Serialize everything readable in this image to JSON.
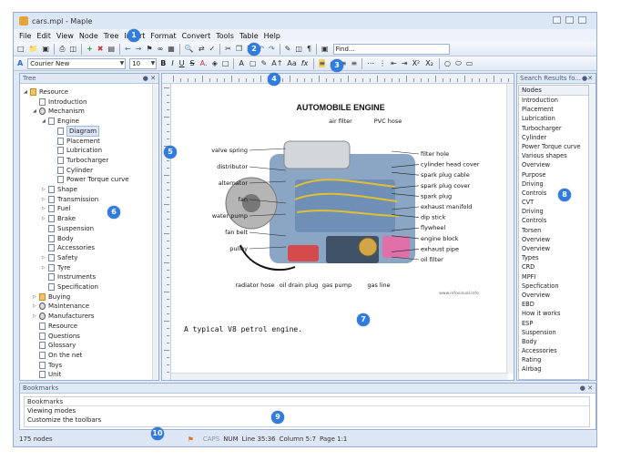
{
  "window": {
    "title": "cars.mpl - Maple"
  },
  "menu": [
    "File",
    "Edit",
    "View",
    "Node",
    "Tree",
    "Insert",
    "Format",
    "Convert",
    "Tools",
    "Table",
    "Help"
  ],
  "toolbar1": {
    "find_placeholder": "Find..."
  },
  "toolbar2": {
    "font": "Courier New",
    "size": "10",
    "format_buttons": [
      "B",
      "I",
      "U",
      "S",
      "A",
      "fx",
      "X²",
      "X₂"
    ]
  },
  "tree": {
    "header": "Tree",
    "items": [
      {
        "label": "Resource",
        "level": 0,
        "type": "folder",
        "expanded": true
      },
      {
        "label": "Introduction",
        "level": 1,
        "type": "page"
      },
      {
        "label": "Mechanism",
        "level": 1,
        "type": "gear",
        "expanded": true
      },
      {
        "label": "Engine",
        "level": 2,
        "type": "page",
        "expanded": true
      },
      {
        "label": "Diagram",
        "level": 3,
        "type": "page",
        "selected": true
      },
      {
        "label": "Placement",
        "level": 3,
        "type": "page"
      },
      {
        "label": "Lubrication",
        "level": 3,
        "type": "page"
      },
      {
        "label": "Turbocharger",
        "level": 3,
        "type": "page"
      },
      {
        "label": "Cylinder",
        "level": 3,
        "type": "page"
      },
      {
        "label": "Power Torque curve",
        "level": 3,
        "type": "page"
      },
      {
        "label": "Shape",
        "level": 2,
        "type": "page",
        "collapsed": true
      },
      {
        "label": "Transmission",
        "level": 2,
        "type": "page",
        "collapsed": true
      },
      {
        "label": "Fuel",
        "level": 2,
        "type": "page",
        "collapsed": true
      },
      {
        "label": "Brake",
        "level": 2,
        "type": "page",
        "collapsed": true
      },
      {
        "label": "Suspension",
        "level": 2,
        "type": "page"
      },
      {
        "label": "Body",
        "level": 2,
        "type": "page"
      },
      {
        "label": "Accessories",
        "level": 2,
        "type": "page"
      },
      {
        "label": "Safety",
        "level": 2,
        "type": "page",
        "collapsed": true
      },
      {
        "label": "Tyre",
        "level": 2,
        "type": "page",
        "collapsed": true
      },
      {
        "label": "Instruments",
        "level": 2,
        "type": "page"
      },
      {
        "label": "Specification",
        "level": 2,
        "type": "page"
      },
      {
        "label": "Buying",
        "level": 1,
        "type": "folder",
        "collapsed": true
      },
      {
        "label": "Maintenance",
        "level": 1,
        "type": "gear",
        "collapsed": true
      },
      {
        "label": "Manufacturers",
        "level": 1,
        "type": "gear",
        "collapsed": true
      },
      {
        "label": "Resource",
        "level": 1,
        "type": "pen"
      },
      {
        "label": "Questions",
        "level": 1,
        "type": "page"
      },
      {
        "label": "Glossary",
        "level": 1,
        "type": "page"
      },
      {
        "label": "On the net",
        "level": 1,
        "type": "page"
      },
      {
        "label": "Toys",
        "level": 1,
        "type": "page"
      },
      {
        "label": "Unit",
        "level": 1,
        "type": "page"
      }
    ]
  },
  "editor": {
    "image_title": "AUTOMOBILE ENGINE",
    "labels_left": [
      "valve spring",
      "distributor",
      "alternator",
      "fan",
      "water pump",
      "fan belt",
      "pulley"
    ],
    "labels_right": [
      "filter hole",
      "cylinder head cover",
      "spark plug cable",
      "spark plug cover",
      "spark plug",
      "exhaust manifold",
      "dip stick",
      "flywheel",
      "engine block",
      "exhaust pipe",
      "oil filter"
    ],
    "labels_top": [
      "air filter",
      "PVC hose"
    ],
    "labels_bottom": [
      "radiator hose",
      "oil drain plug",
      "gas pump",
      "gas line"
    ],
    "watermark": "www.infovisual.info",
    "caption": "A typical V8 petrol engine."
  },
  "search": {
    "header": "Search Results fo...",
    "column": "Nodes",
    "results": [
      "Introduction",
      "Placement",
      "Lubrication",
      "Turbocharger",
      "Cylinder",
      "Power Torque curve",
      "Various shapes",
      "Overview",
      "Purpose",
      "Driving",
      "Controls",
      "CVT",
      "Driving",
      "Controls",
      "Torsen",
      "Overview",
      "Overview",
      "Types",
      "CRD",
      "MPFI",
      "Specfication",
      "Overview",
      "EBD",
      "How it works",
      "ESP",
      "Suspension",
      "Body",
      "Accessories",
      "Rating",
      "Airbag"
    ]
  },
  "bookmarks": {
    "header": "Bookmarks",
    "column": "Bookmarks",
    "items": [
      "Viewing modes",
      "Customize the toolbars"
    ]
  },
  "status": {
    "nodes": "175 nodes",
    "caps": "CAPS",
    "num": "NUM",
    "line": "Line 35:36",
    "column": "Column 5:7",
    "page": "Page 1:1"
  },
  "markers": [
    "1",
    "2",
    "3",
    "4",
    "5",
    "6",
    "7",
    "8",
    "9",
    "10"
  ]
}
